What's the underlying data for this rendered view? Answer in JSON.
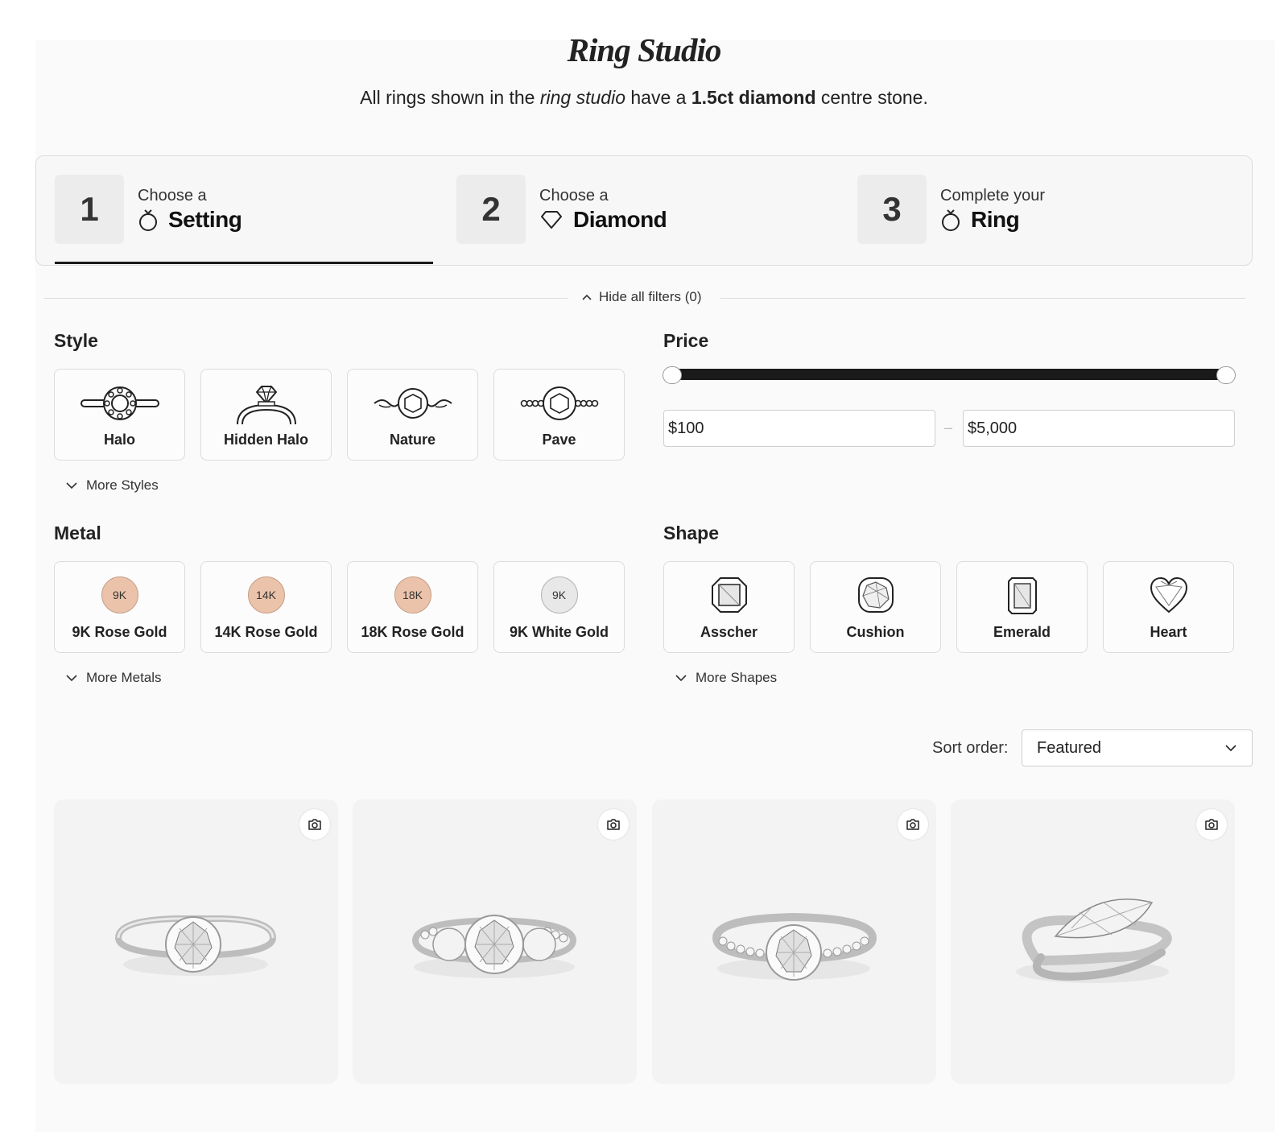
{
  "header": {
    "title": "Ring Studio",
    "subtitle_pre": "All rings shown in the ",
    "subtitle_em": "ring studio",
    "subtitle_mid": " have a ",
    "subtitle_bold": "1.5ct diamond",
    "subtitle_post": " centre stone."
  },
  "steps": [
    {
      "number": "1",
      "pre": "Choose a",
      "label": "Setting",
      "icon": "ring-icon",
      "active": true
    },
    {
      "number": "2",
      "pre": "Choose a",
      "label": "Diamond",
      "icon": "diamond-icon",
      "active": false
    },
    {
      "number": "3",
      "pre": "Complete your",
      "label": "Ring",
      "icon": "ring-icon",
      "active": false
    }
  ],
  "filters": {
    "toggle_label": "Hide all filters (0)",
    "style": {
      "title": "Style",
      "options": [
        {
          "label": "Halo",
          "icon": "halo-icon"
        },
        {
          "label": "Hidden Halo",
          "icon": "hidden-halo-icon"
        },
        {
          "label": "Nature",
          "icon": "nature-icon"
        },
        {
          "label": "Pave",
          "icon": "pave-icon"
        }
      ],
      "more_label": "More Styles"
    },
    "price": {
      "title": "Price",
      "min": "$100",
      "max": "$5,000",
      "separator": "–"
    },
    "metal": {
      "title": "Metal",
      "options": [
        {
          "label": "9K Rose Gold",
          "chip": "9K",
          "color": "#ebc3aa"
        },
        {
          "label": "14K Rose Gold",
          "chip": "14K",
          "color": "#ebc3aa"
        },
        {
          "label": "18K Rose Gold",
          "chip": "18K",
          "color": "#ebc3aa"
        },
        {
          "label": "9K White Gold",
          "chip": "9K",
          "color": "#e8e8e8"
        }
      ],
      "more_label": "More Metals"
    },
    "shape": {
      "title": "Shape",
      "options": [
        {
          "label": "Asscher",
          "icon": "asscher-icon"
        },
        {
          "label": "Cushion",
          "icon": "cushion-icon"
        },
        {
          "label": "Emerald",
          "icon": "emerald-icon"
        },
        {
          "label": "Heart",
          "icon": "heart-icon"
        }
      ],
      "more_label": "More Shapes"
    }
  },
  "sort": {
    "label": "Sort order:",
    "value": "Featured"
  },
  "products": [
    {
      "image": "solitaire-ring"
    },
    {
      "image": "three-stone-ring"
    },
    {
      "image": "pave-solitaire-ring"
    },
    {
      "image": "marquise-bypass-ring"
    }
  ]
}
